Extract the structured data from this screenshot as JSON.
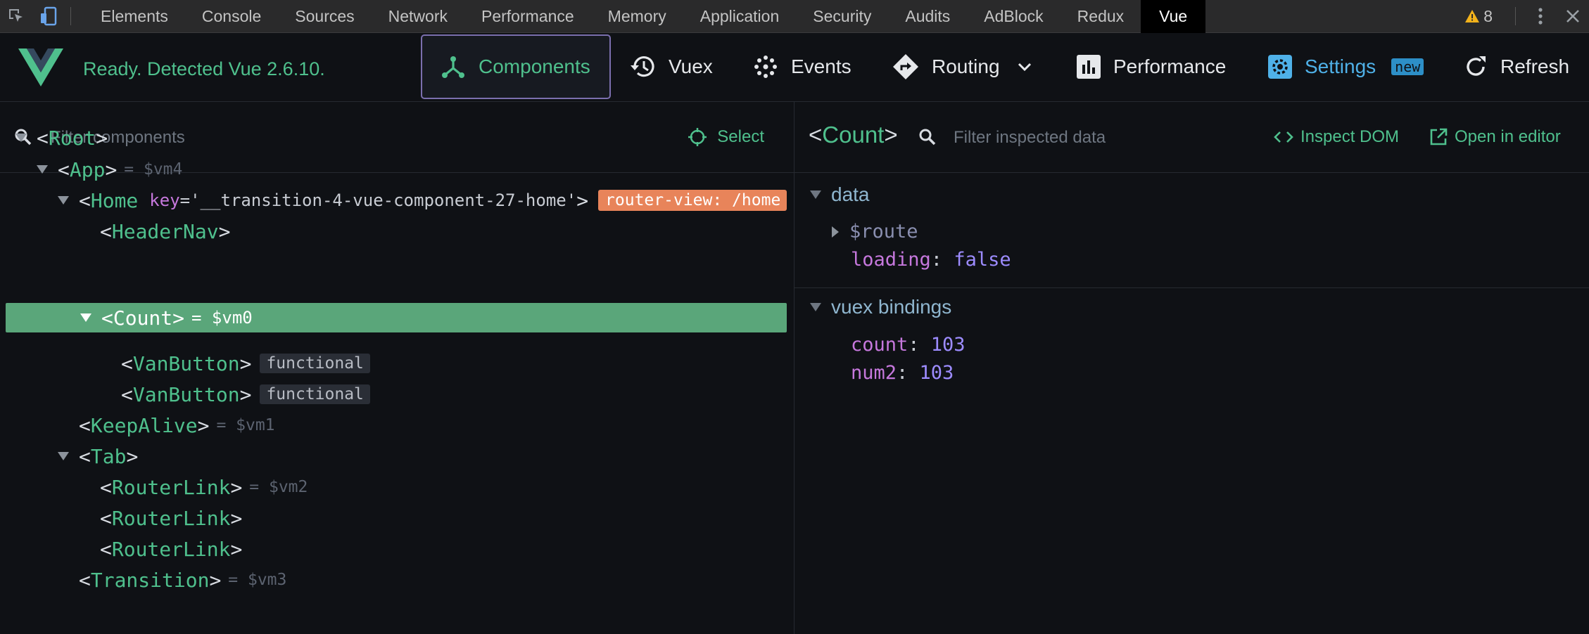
{
  "devtools_tabs": [
    "Elements",
    "Console",
    "Sources",
    "Network",
    "Performance",
    "Memory",
    "Application",
    "Security",
    "Audits",
    "AdBlock",
    "Redux",
    "Vue"
  ],
  "active_tab": "Vue",
  "warnings_count": "8",
  "toolbar": {
    "status": "Ready. Detected Vue 2.6.10.",
    "components_label": "Components",
    "vuex_label": "Vuex",
    "events_label": "Events",
    "routing_label": "Routing",
    "performance_label": "Performance",
    "settings_label": "Settings",
    "settings_badge": "new",
    "refresh_label": "Refresh"
  },
  "left": {
    "filter_placeholder": "Filter components",
    "select_label": "Select"
  },
  "tree": {
    "root": "Root",
    "app": "App",
    "app_vm": "= $vm4",
    "home": "Home",
    "home_key_name": "key",
    "home_key_val": "='__transition-4-vue-component-27-home'",
    "home_router_view": "router-view: /home",
    "headernav": "HeaderNav",
    "count": "Count",
    "count_vm": "= $vm0",
    "vanbutton": "VanButton",
    "functional": "functional",
    "keepalive": "KeepAlive",
    "keepalive_vm": "= $vm1",
    "tab": "Tab",
    "routerlink": "RouterLink",
    "routerlink_vm": "= $vm2",
    "transition": "Transition",
    "transition_vm": "= $vm3"
  },
  "right": {
    "inspected": "Count",
    "filter_placeholder": "Filter inspected data",
    "inspect_dom": "Inspect DOM",
    "open_editor": "Open in editor",
    "data_title": "data",
    "route_key": "$route",
    "loading_key": "loading",
    "loading_val": "false",
    "vuex_title": "vuex bindings",
    "count_key": "count",
    "count_val": "103",
    "num2_key": "num2",
    "num2_val": "103"
  },
  "colors": {
    "vue_green": "#4fc08d",
    "selection": "#5aa67a",
    "router_badge": "#e8845a"
  }
}
